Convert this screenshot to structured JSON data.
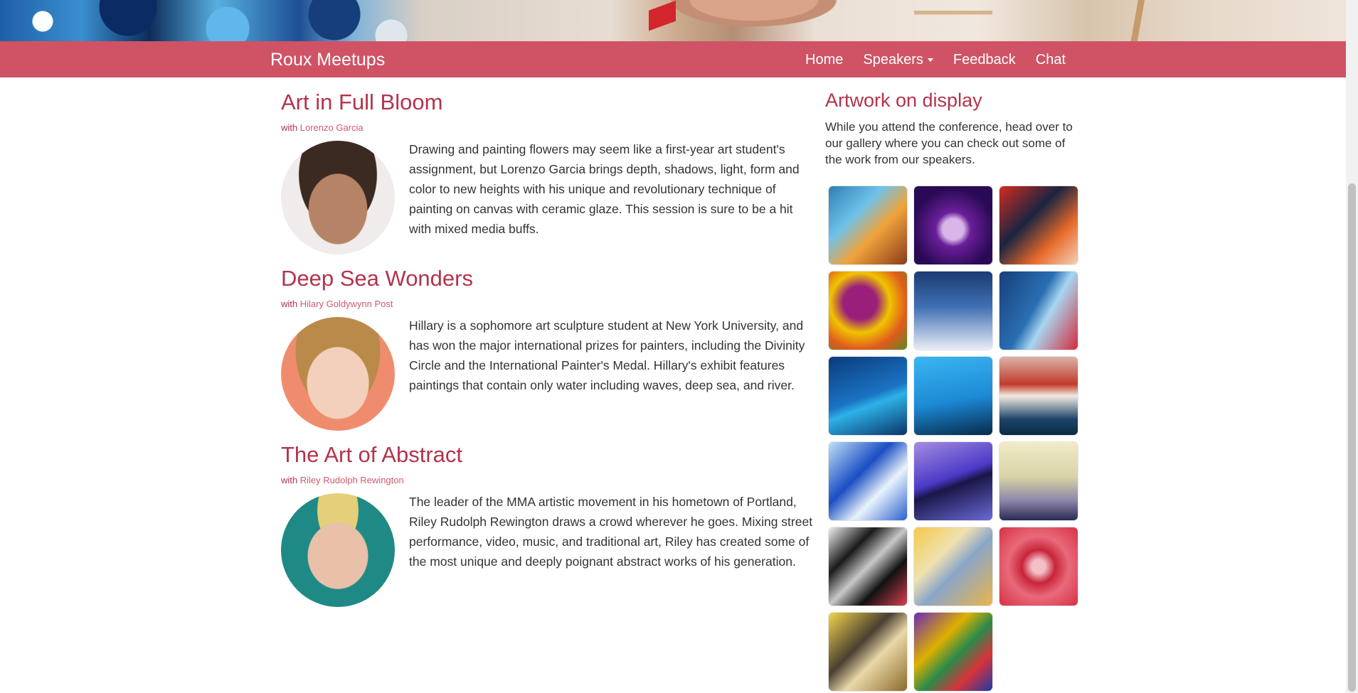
{
  "navbar": {
    "brand": "Roux Meetups",
    "links": [
      {
        "label": "Home"
      },
      {
        "label": "Speakers",
        "dropdown": true
      },
      {
        "label": "Feedback"
      },
      {
        "label": "Chat"
      }
    ]
  },
  "talks": [
    {
      "title": "Art in Full Bloom",
      "with": "with",
      "speaker": "Lorenzo Garcia",
      "description": "Drawing and painting flowers may seem like a first-year art student's assignment, but Lorenzo Garcia brings depth, shadows, light, form and color to new heights with his unique and revolutionary technique of painting on canvas with ceramic glaze. This session is sure to be a hit with mixed media buffs."
    },
    {
      "title": "Deep Sea Wonders",
      "with": "with",
      "speaker": "Hilary Goldywynn Post",
      "description": "Hillary is a sophomore art sculpture student at New York University, and has won the major international prizes for painters, including the Divinity Circle and the International Painter's Medal. Hillary's exhibit features paintings that contain only water including waves, deep sea, and river."
    },
    {
      "title": "The Art of Abstract",
      "with": "with",
      "speaker": "Riley Rudolph Rewington",
      "description": "The leader of the MMA artistic movement in his hometown of Portland, Riley Rudolph Rewington draws a crowd wherever he goes. Mixing street performance, video, music, and traditional art, Riley has created some of the most unique and deeply poignant abstract works of his generation."
    }
  ],
  "sidebar": {
    "title": "Artwork on display",
    "intro": "While you attend the conference, head over to our gallery where you can check out some of the work from our speakers."
  },
  "colors": {
    "navbar": "#cf5365",
    "accent": "#b3334a"
  }
}
